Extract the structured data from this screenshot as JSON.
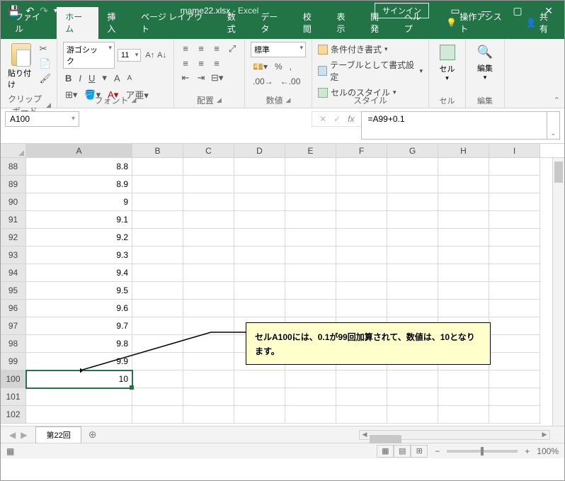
{
  "title": {
    "filename": "mame22.xlsx",
    "app": "Excel",
    "signin": "サインイン"
  },
  "tabs": {
    "file": "ファイル",
    "home": "ホーム",
    "insert": "挿入",
    "layout": "ページ レイアウト",
    "formulas": "数式",
    "data": "データ",
    "review": "校閲",
    "view": "表示",
    "dev": "開発",
    "help": "ヘルプ",
    "tell": "操作アシスト",
    "share": "共有"
  },
  "ribbon": {
    "clipboard": {
      "paste": "貼り付け",
      "label": "クリップボード"
    },
    "font": {
      "name": "游ゴシック",
      "size": "11",
      "label": "フォント",
      "bold": "B",
      "italic": "I",
      "underline": "U"
    },
    "align": {
      "label": "配置"
    },
    "number": {
      "format": "標準",
      "label": "数値"
    },
    "styles": {
      "cond": "条件付き書式",
      "table": "テーブルとして書式設定",
      "cell": "セルのスタイル",
      "label": "スタイル"
    },
    "cells": {
      "btn": "セル",
      "label": "セル"
    },
    "edit": {
      "btn": "編集",
      "label": "編集"
    }
  },
  "fx": {
    "namebox": "A100",
    "formula": "=A99+0.1"
  },
  "cols": [
    "A",
    "B",
    "C",
    "D",
    "E",
    "F",
    "G",
    "H",
    "I"
  ],
  "rows": [
    {
      "n": "88",
      "a": "8.8"
    },
    {
      "n": "89",
      "a": "8.9"
    },
    {
      "n": "90",
      "a": "9"
    },
    {
      "n": "91",
      "a": "9.1"
    },
    {
      "n": "92",
      "a": "9.2"
    },
    {
      "n": "93",
      "a": "9.3"
    },
    {
      "n": "94",
      "a": "9.4"
    },
    {
      "n": "95",
      "a": "9.5"
    },
    {
      "n": "96",
      "a": "9.6"
    },
    {
      "n": "97",
      "a": "9.7"
    },
    {
      "n": "98",
      "a": "9.8"
    },
    {
      "n": "99",
      "a": "9.9"
    },
    {
      "n": "100",
      "a": "10",
      "sel": true
    },
    {
      "n": "101",
      "a": ""
    },
    {
      "n": "102",
      "a": ""
    }
  ],
  "callout": "セルA100には、0.1が99回加算されて、数値は、10となります。",
  "sheet": {
    "tab": "第22回"
  },
  "status": {
    "zoom": "100%"
  }
}
